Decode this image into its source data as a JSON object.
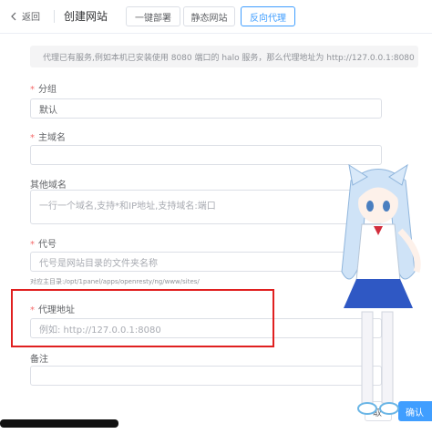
{
  "header": {
    "back_label": "返回",
    "title": "创建网站",
    "tabs": [
      {
        "label": "一键部署",
        "active": false
      },
      {
        "label": "静态网站",
        "active": false
      },
      {
        "label": "反向代理",
        "active": true
      }
    ]
  },
  "alert": {
    "text": "代理已有服务,例如本机已安装使用 8080 端口的 halo 服务，那么代理地址为 http://127.0.0.1:8080"
  },
  "form": {
    "group": {
      "label": "分组",
      "value": "默认"
    },
    "primary_domain": {
      "label": "主域名",
      "value": ""
    },
    "other_domains": {
      "label": "其他域名",
      "placeholder": "一行一个域名,支持*和IP地址,支持域名:端口"
    },
    "alias": {
      "label": "代号",
      "placeholder": "代号是网站目录的文件夹名称",
      "hint": "对应主目录:/opt/1panel/apps/openresty/ng/www/sites/"
    },
    "proxy_address": {
      "label": "代理地址",
      "placeholder": "例如: http://127.0.0.1:8080"
    },
    "remark": {
      "label": "备注",
      "value": ""
    }
  },
  "footer": {
    "cancel_label": "取",
    "confirm_label": "确认"
  },
  "colors": {
    "primary": "#409eff",
    "highlight": "#e02020",
    "required": "#f56c6c"
  }
}
